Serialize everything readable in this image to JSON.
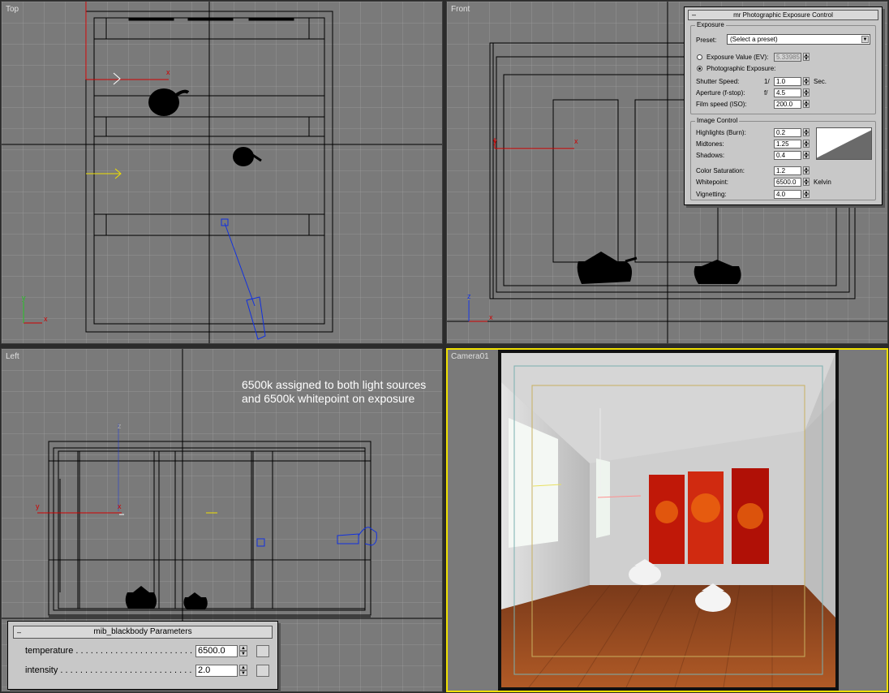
{
  "viewports": {
    "top": {
      "label": "Top"
    },
    "front": {
      "label": "Front"
    },
    "left": {
      "label": "Left"
    },
    "camera": {
      "label": "Camera01"
    }
  },
  "axes": {
    "x": "x",
    "y": "y",
    "z": "z"
  },
  "note": {
    "line1": "6500k assigned to both light sources",
    "line2": "and 6500k whitepoint on exposure"
  },
  "exposure_panel": {
    "title": "mr Photographic Exposure Control",
    "exposure_group": "Exposure",
    "preset_label": "Preset:",
    "preset_value": "(Select a preset)",
    "ev_label": "Exposure Value (EV):",
    "ev_value": "5.33985",
    "photo_label": "Photographic Exposure:",
    "shutter_label": "Shutter Speed:",
    "shutter_prefix": "1/",
    "shutter_value": "1.0",
    "shutter_unit": "Sec.",
    "aperture_label": "Aperture (f-stop):",
    "aperture_prefix": "f/",
    "aperture_value": "4.5",
    "iso_label": "Film speed (ISO):",
    "iso_value": "200.0",
    "image_group": "Image Control",
    "highlights_label": "Highlights (Burn):",
    "highlights_value": "0.2",
    "midtones_label": "Midtones:",
    "midtones_value": "1.25",
    "shadows_label": "Shadows:",
    "shadows_value": "0.4",
    "saturation_label": "Color Saturation:",
    "saturation_value": "1.2",
    "whitepoint_label": "Whitepoint:",
    "whitepoint_value": "6500.0",
    "whitepoint_unit": "Kelvin",
    "vignetting_label": "Vignetting:",
    "vignetting_value": "4.0"
  },
  "blackbody_panel": {
    "title": "mib_blackbody Parameters",
    "temperature_label": "temperature . . . . . . . . . . . . . . . . . . . . . . . .",
    "temperature_value": "6500.0",
    "intensity_label": "intensity . . . . . . . . . . . . . . . . . . . . . . . . . . .",
    "intensity_value": "2.0"
  },
  "colors": {
    "viewport_bg": "#7a7a7a",
    "active_border": "#f0e000",
    "axis_x": "#ff2020",
    "axis_y": "#20c020",
    "light_blue": "#1030e0"
  }
}
